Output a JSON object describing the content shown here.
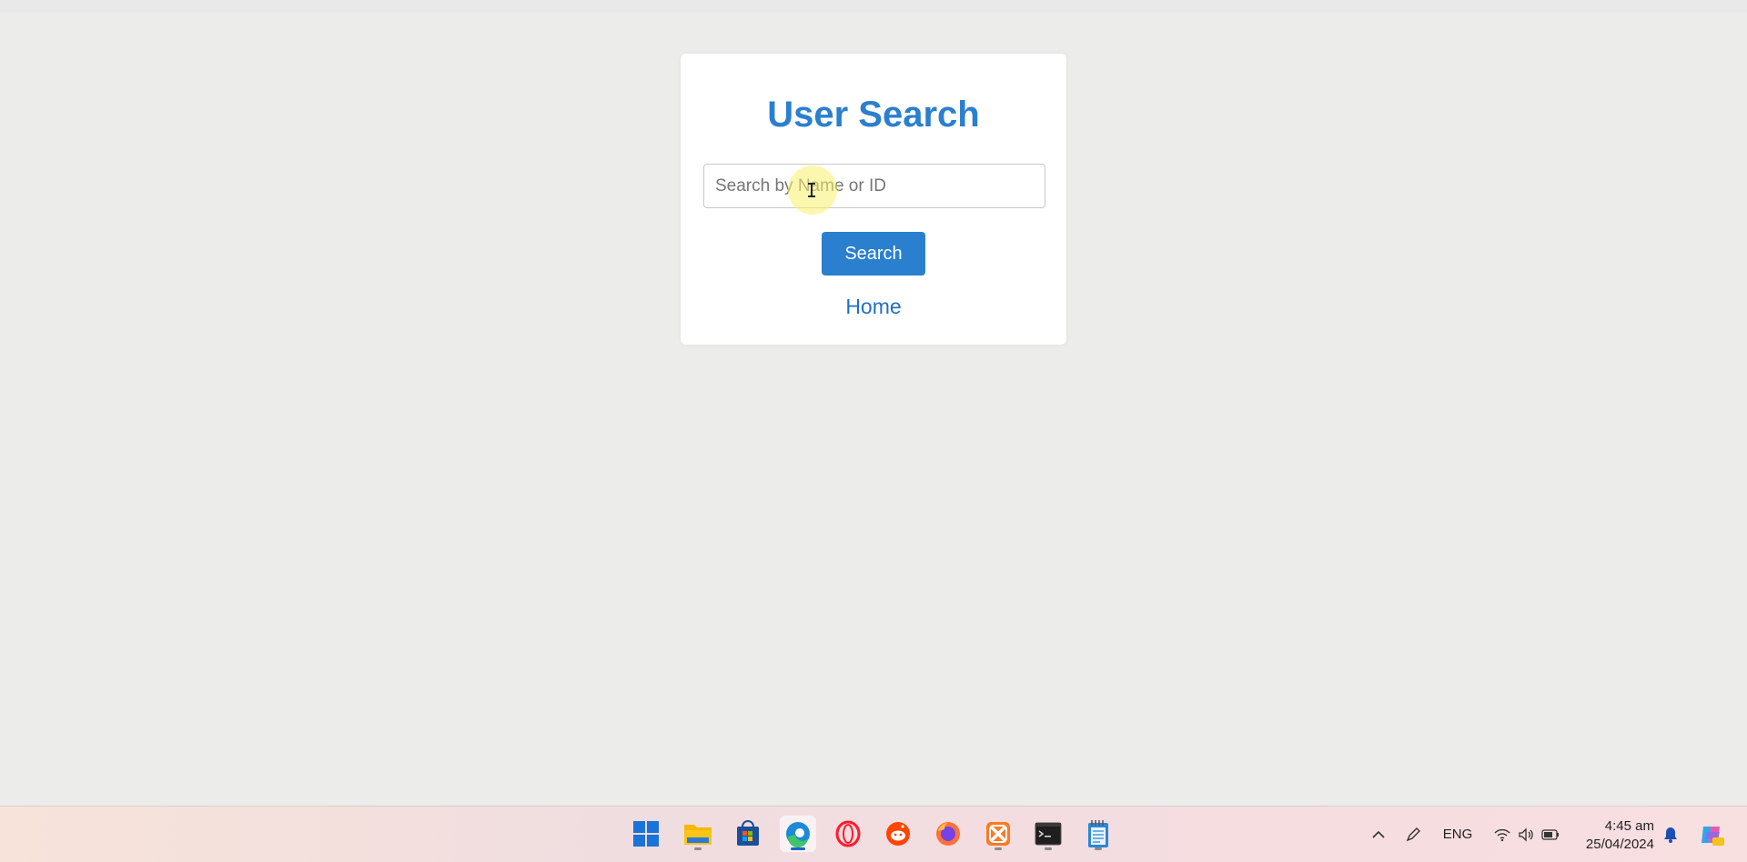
{
  "page": {
    "title": "User Search",
    "search": {
      "placeholder": "Search by Name or ID",
      "value": ""
    },
    "search_button": "Search",
    "home_link": "Home",
    "colors": {
      "accent": "#2a7fcf",
      "background": "#ececea",
      "card": "#ffffff"
    }
  },
  "taskbar": {
    "apps": [
      {
        "name": "start",
        "icon": "windows-logo-icon",
        "running": false
      },
      {
        "name": "file-explorer",
        "icon": "folder-icon",
        "running": true
      },
      {
        "name": "microsoft-store",
        "icon": "store-icon",
        "running": false
      },
      {
        "name": "edge",
        "icon": "edge-icon",
        "running": true,
        "active": true
      },
      {
        "name": "opera",
        "icon": "opera-icon",
        "running": false
      },
      {
        "name": "reddit",
        "icon": "reddit-icon",
        "running": false
      },
      {
        "name": "firefox",
        "icon": "firefox-icon",
        "running": false
      },
      {
        "name": "xampp",
        "icon": "xampp-icon",
        "running": true
      },
      {
        "name": "terminal",
        "icon": "terminal-icon",
        "running": true
      },
      {
        "name": "notepad",
        "icon": "notepad-icon",
        "running": true
      }
    ],
    "tray": {
      "language": "ENG",
      "time": "4:45 am",
      "date": "25/04/2024"
    }
  }
}
